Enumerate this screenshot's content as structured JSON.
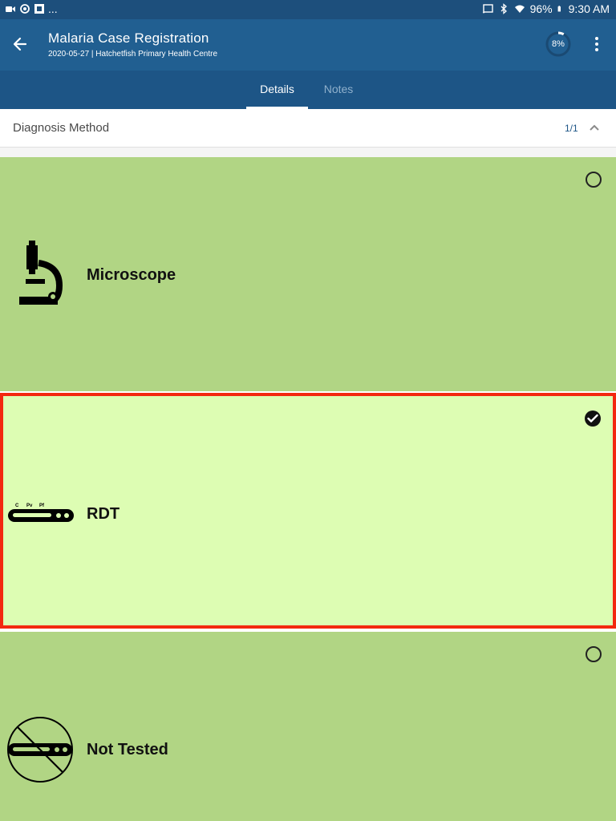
{
  "status_bar": {
    "left_more": "...",
    "battery": "96%",
    "time": "9:30 AM"
  },
  "app_bar": {
    "title": "Malaria Case Registration",
    "subtitle": "2020-05-27 | Hatchetfish Primary Health Centre",
    "progress": "8%",
    "progress_fraction": 0.08
  },
  "tabs": [
    {
      "label": "Details",
      "active": true
    },
    {
      "label": "Notes",
      "active": false
    }
  ],
  "section": {
    "title": "Diagnosis Method",
    "count": "1/1"
  },
  "options": [
    {
      "label": "Microscope",
      "icon": "microscope-icon",
      "selected": false
    },
    {
      "label": "RDT",
      "icon": "rdt-strip-icon",
      "selected": true
    },
    {
      "label": "Not Tested",
      "icon": "not-tested-icon",
      "selected": false
    }
  ],
  "rdt_strip_marks": [
    "C",
    "Pv",
    "Pf"
  ],
  "colors": {
    "status_bar": "#1d4f7c",
    "app_bar": "#215f91",
    "tab_bar": "#1d5586",
    "option_bg": "#b1d584",
    "option_selected_bg": "#ddfdb3",
    "selected_border": "#f3280f"
  }
}
